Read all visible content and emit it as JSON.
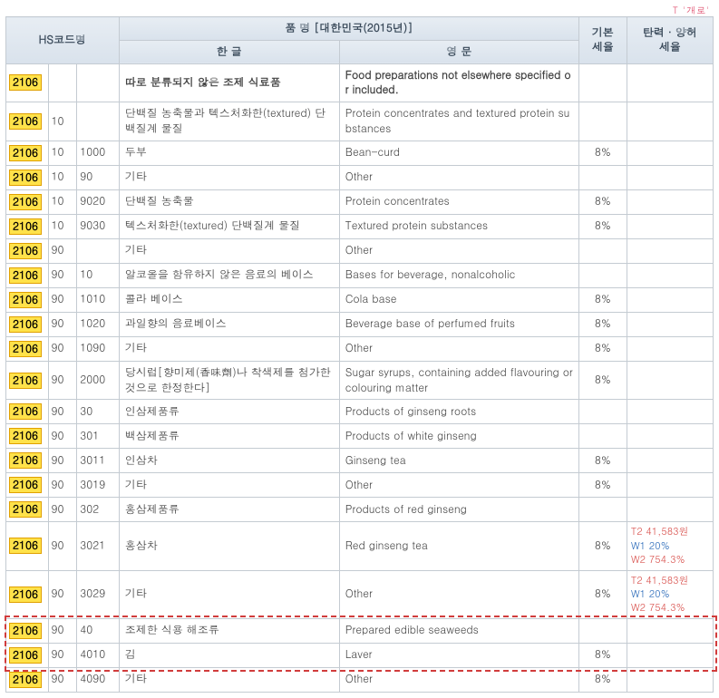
{
  "topRight": "T  '개로'",
  "headers": {
    "hscode": "HS코드명",
    "product": "품 명  [대한민국(2015년)]",
    "korean": "한  글",
    "english": "영  문",
    "baseRate": "기본\n세율",
    "flexRate": "탄력 · 양허\n세율"
  },
  "rows": [
    {
      "section": true,
      "c1": "2106",
      "c2": "",
      "c3": "",
      "kr": "따로 분류되지 않은 조제 식료품",
      "en": "Food preparations not elsewhere specified or included.",
      "rate": "",
      "extra": []
    },
    {
      "c1": "2106",
      "c2": "10",
      "c3": "",
      "kr": "단백질 농축물과 텍스처화한(textured) 단백질계 물질",
      "en": "Protein concentrates and textured protein substances",
      "rate": "",
      "extra": []
    },
    {
      "c1": "2106",
      "c2": "10",
      "c3": "1000",
      "kr": "두부",
      "en": "Bean-curd",
      "rate": "8%",
      "extra": []
    },
    {
      "c1": "2106",
      "c2": "10",
      "c3": "90",
      "kr": "기타",
      "en": "Other",
      "rate": "",
      "extra": []
    },
    {
      "c1": "2106",
      "c2": "10",
      "c3": "9020",
      "kr": "단백질 농축물",
      "en": "Protein concentrates",
      "rate": "8%",
      "extra": []
    },
    {
      "c1": "2106",
      "c2": "10",
      "c3": "9030",
      "kr": "텍스처화한(textured) 단백질계 물질",
      "en": "Textured protein substances",
      "rate": "8%",
      "extra": []
    },
    {
      "c1": "2106",
      "c2": "90",
      "c3": "",
      "kr": "기타",
      "en": "Other",
      "rate": "",
      "extra": []
    },
    {
      "c1": "2106",
      "c2": "90",
      "c3": "10",
      "kr": "알코올을 함유하지 않은 음료의 베이스",
      "en": "Bases for beverage, nonalcoholic",
      "rate": "",
      "extra": []
    },
    {
      "c1": "2106",
      "c2": "90",
      "c3": "1010",
      "kr": "콜라 베이스",
      "en": "Cola base",
      "rate": "8%",
      "extra": []
    },
    {
      "c1": "2106",
      "c2": "90",
      "c3": "1020",
      "kr": "과일향의 음료베이스",
      "en": "Beverage base of perfumed fruits",
      "rate": "8%",
      "extra": []
    },
    {
      "c1": "2106",
      "c2": "90",
      "c3": "1090",
      "kr": "기타",
      "en": "Other",
      "rate": "8%",
      "extra": []
    },
    {
      "c1": "2106",
      "c2": "90",
      "c3": "2000",
      "kr": "당시럽[향미제(香味劑)나 착색제를 첨가한 것으로 한정한다]",
      "en": "Sugar syrups, containing added flavouring or colouring matter",
      "rate": "8%",
      "extra": []
    },
    {
      "c1": "2106",
      "c2": "90",
      "c3": "30",
      "kr": "인삼제품류",
      "en": "Products of ginseng roots",
      "rate": "",
      "extra": []
    },
    {
      "c1": "2106",
      "c2": "90",
      "c3": "301",
      "kr": "백삼제품류",
      "en": "Products of white ginseng",
      "rate": "",
      "extra": []
    },
    {
      "c1": "2106",
      "c2": "90",
      "c3": "3011",
      "kr": "인삼차",
      "en": "Ginseng tea",
      "rate": "8%",
      "extra": []
    },
    {
      "c1": "2106",
      "c2": "90",
      "c3": "3019",
      "kr": "기타",
      "en": "Other",
      "rate": "8%",
      "extra": []
    },
    {
      "c1": "2106",
      "c2": "90",
      "c3": "302",
      "kr": "홍삼제품류",
      "en": "Products of red ginseng",
      "rate": "",
      "extra": []
    },
    {
      "c1": "2106",
      "c2": "90",
      "c3": "3021",
      "kr": "홍삼차",
      "en": "Red ginseng tea",
      "rate": "8%",
      "extra": [
        {
          "cls": "line-r",
          "txt": "T2 41,583원"
        },
        {
          "cls": "line-b",
          "txt": "W1 20%"
        },
        {
          "cls": "line-r",
          "txt": "W2 754.3%"
        }
      ]
    },
    {
      "c1": "2106",
      "c2": "90",
      "c3": "3029",
      "kr": "기타",
      "en": "Other",
      "rate": "8%",
      "extra": [
        {
          "cls": "line-r",
          "txt": "T2 41,583원"
        },
        {
          "cls": "line-b",
          "txt": "W1 20%"
        },
        {
          "cls": "line-r",
          "txt": "W2 754.3%"
        }
      ]
    },
    {
      "c1": "2106",
      "c2": "90",
      "c3": "40",
      "kr": "조제한 식용 해조류",
      "en": "Prepared edible seaweeds",
      "rate": "",
      "extra": []
    },
    {
      "c1": "2106",
      "c2": "90",
      "c3": "4010",
      "kr": "김",
      "en": "Laver",
      "rate": "8%",
      "extra": []
    },
    {
      "c1": "2106",
      "c2": "90",
      "c3": "4090",
      "kr": "기타",
      "en": "Other",
      "rate": "8%",
      "extra": []
    }
  ],
  "dashRows": [
    19,
    20
  ]
}
